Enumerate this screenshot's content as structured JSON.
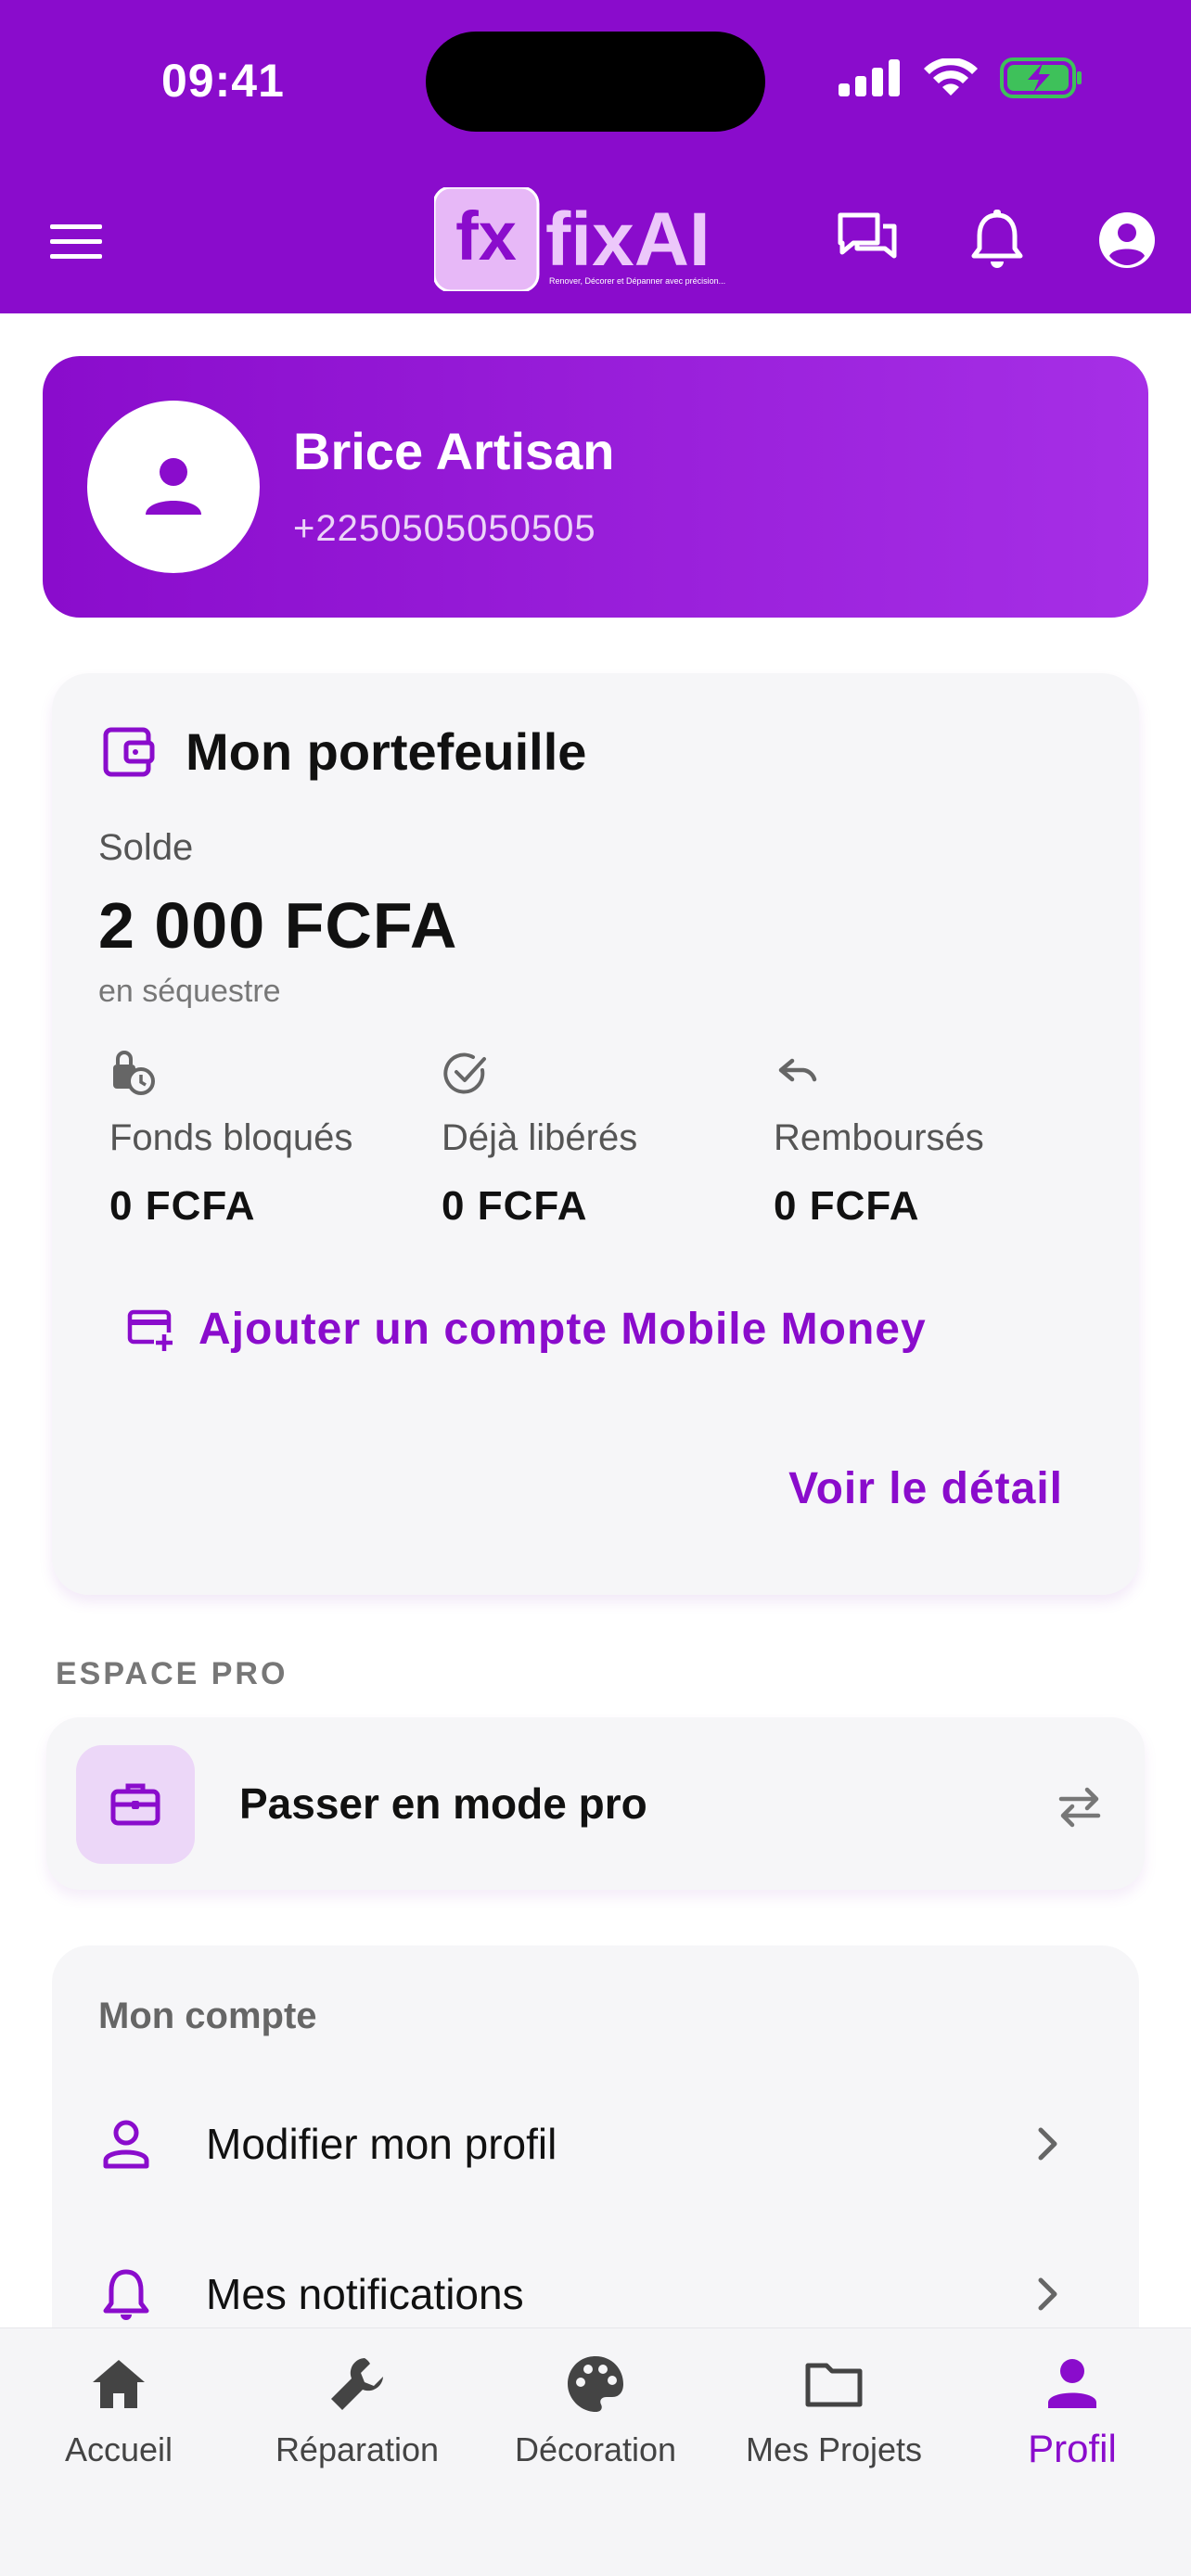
{
  "status_bar": {
    "time": "09:41"
  },
  "header": {
    "logo_mark": "fx",
    "logo_text": "fixAI",
    "logo_tagline": "Renover, Décorer et Dépanner avec précision...",
    "icons": [
      "menu-icon",
      "chat-icon",
      "bell-icon",
      "account-icon"
    ]
  },
  "profile": {
    "name": "Brice Artisan",
    "phone": "+2250505050505"
  },
  "wallet": {
    "title": "Mon portefeuille",
    "balance_label": "Solde",
    "balance_value": "2 000 FCFA",
    "balance_sub": "en séquestre",
    "stats": [
      {
        "icon": "locked-clock-icon",
        "label": "Fonds bloqués",
        "value": "0 FCFA"
      },
      {
        "icon": "check-circle-icon",
        "label": "Déjà libérés",
        "value": "0 FCFA"
      },
      {
        "icon": "undo-icon",
        "label": "Remboursés",
        "value": "0 FCFA"
      }
    ],
    "add_mobile_money": "Ajouter un compte Mobile Money",
    "detail_link": "Voir le détail"
  },
  "pro_space": {
    "section_label": "ESPACE PRO",
    "switch_label": "Passer en mode pro"
  },
  "account": {
    "title": "Mon compte",
    "items": [
      {
        "icon": "person-icon",
        "label": "Modifier mon profil"
      },
      {
        "icon": "bell-icon",
        "label": "Mes notifications"
      }
    ]
  },
  "bottom_nav": {
    "items": [
      {
        "icon": "home-icon",
        "label": "Accueil"
      },
      {
        "icon": "wrench-icon",
        "label": "Réparation"
      },
      {
        "icon": "palette-icon",
        "label": "Décoration"
      },
      {
        "icon": "folder-icon",
        "label": "Mes Projets"
      },
      {
        "icon": "person-icon",
        "label": "Profil"
      }
    ],
    "active": "Profil"
  },
  "colors": {
    "brand": "#8a0ccc",
    "brand_light": "#a62fe6",
    "card_bg": "#f6f6f8",
    "pro_icon_bg": "#ecd7f8",
    "battery": "#3ec15a"
  }
}
